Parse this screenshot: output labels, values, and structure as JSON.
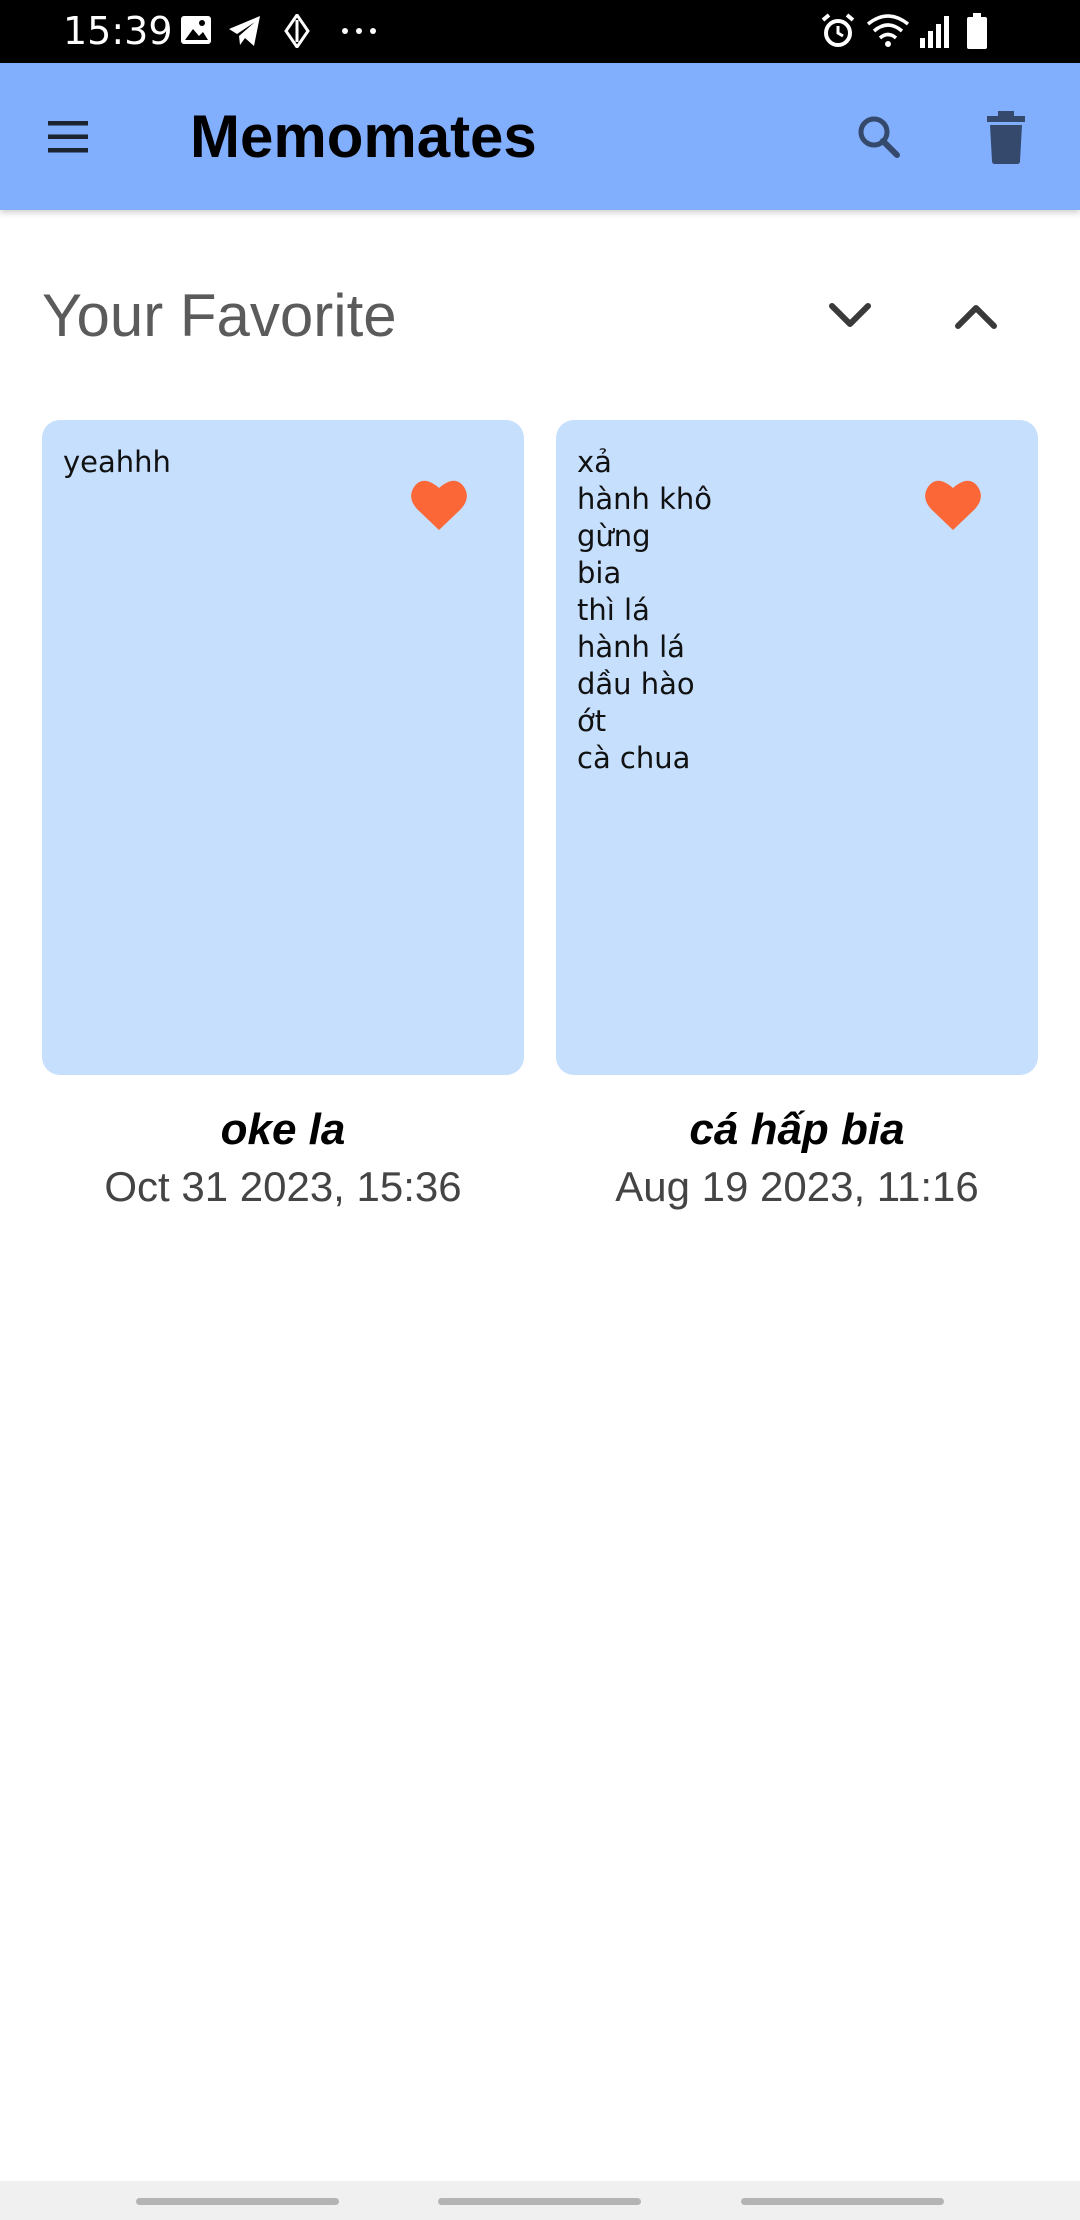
{
  "status_bar": {
    "time": "15:39"
  },
  "app_bar": {
    "title": "Memomates",
    "background": "#82aefe",
    "icons": [
      "menu-icon",
      "search-icon",
      "delete-icon"
    ]
  },
  "section": {
    "title": "Your Favorite",
    "icons": [
      "chevron-down-icon",
      "chevron-up-icon"
    ]
  },
  "notes": [
    {
      "content_lines": [
        "yeahhh"
      ],
      "title": "oke la",
      "date": "Oct 31 2023, 15:36",
      "favorite": true
    },
    {
      "content_lines": [
        "xả",
        "hành khô",
        "gừng",
        "bia",
        "thì lá",
        "hành lá",
        "dầu hào",
        "ớt",
        "cà chua"
      ],
      "title": "cá hấp bia",
      "date": "Aug 19 2023, 11:16",
      "favorite": true
    }
  ],
  "colors": {
    "card": "#c6dffd",
    "heart": "#fb6736",
    "icon_dark": "#34496c"
  }
}
